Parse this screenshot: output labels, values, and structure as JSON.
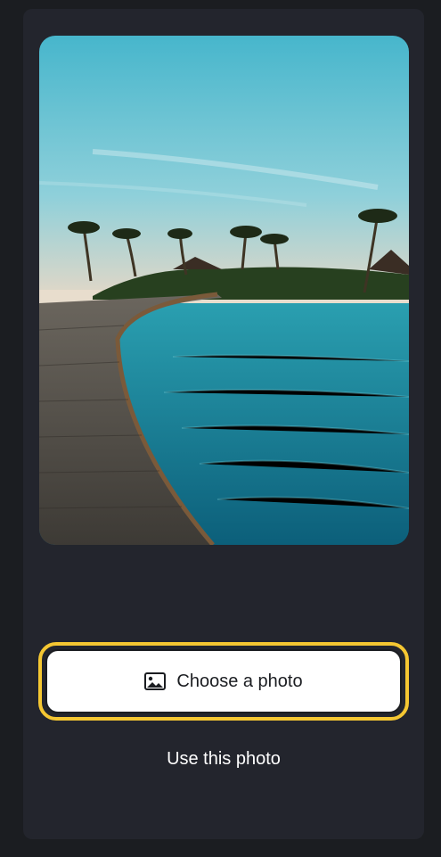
{
  "preview": {
    "image_description_icon": "photo-preview"
  },
  "actions": {
    "choose_label": "Choose a photo",
    "choose_icon": "image-icon",
    "use_label": "Use this photo"
  },
  "colors": {
    "background": "#1b1d21",
    "card": "#23252d",
    "focus_ring": "#f5c732",
    "button_bg": "#ffffff"
  }
}
